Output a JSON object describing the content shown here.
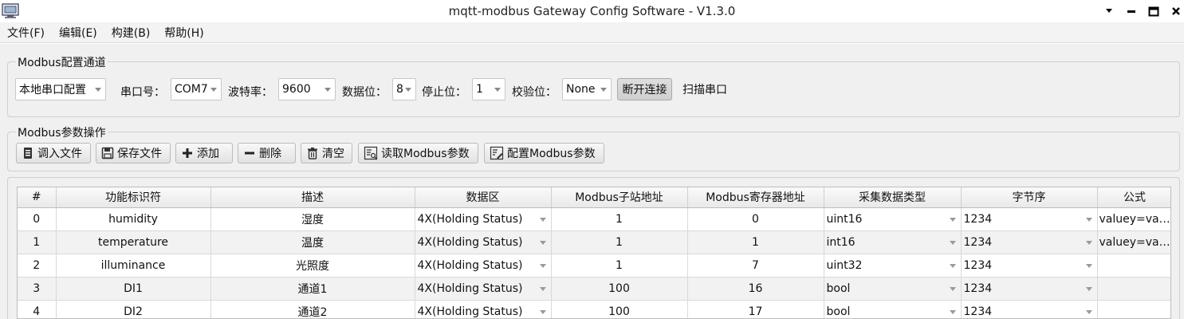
{
  "window": {
    "title": "mqtt-modbus Gateway Config Software - V1.3.0",
    "icon": "computer-app-icon"
  },
  "menu": [
    {
      "label": "文件(F)"
    },
    {
      "label": "编辑(E)"
    },
    {
      "label": "构建(B)"
    },
    {
      "label": "帮助(H)"
    }
  ],
  "channel": {
    "title": "Modbus配置通道",
    "mode": "本地串口配置",
    "port_label": "串口号：",
    "port": "COM7",
    "baud_label": "波特率：",
    "baud": "9600",
    "databits_label": "数据位：",
    "databits": "8",
    "stopbits_label": "停止位：",
    "stopbits": "1",
    "parity_label": "校验位：",
    "parity": "None",
    "disconnect_label": "断开连接",
    "scan_label": "扫描串口"
  },
  "params": {
    "title": "Modbus参数操作",
    "load_label": "调入文件",
    "save_label": "保存文件",
    "add_label": "添加",
    "delete_label": "删除",
    "clear_label": "清空",
    "read_label": "读取Modbus参数",
    "write_label": "配置Modbus参数"
  },
  "table": {
    "headers": [
      "#",
      "功能标识符",
      "描述",
      "数据区",
      "Modbus子站地址",
      "Modbus寄存器地址",
      "采集数据类型",
      "字节序",
      "公式"
    ],
    "rows": [
      {
        "idx": "0",
        "id": "humidity",
        "desc": "湿度",
        "area": "4X(Holding Status)",
        "slave": "1",
        "reg": "0",
        "type": "uint16",
        "order": "1234",
        "formula": "valuey=value..."
      },
      {
        "idx": "1",
        "id": "temperature",
        "desc": "温度",
        "area": "4X(Holding Status)",
        "slave": "1",
        "reg": "1",
        "type": "int16",
        "order": "1234",
        "formula": "valuey=value..."
      },
      {
        "idx": "2",
        "id": "illuminance",
        "desc": "光照度",
        "area": "4X(Holding Status)",
        "slave": "1",
        "reg": "7",
        "type": "uint32",
        "order": "1234",
        "formula": ""
      },
      {
        "idx": "3",
        "id": "DI1",
        "desc": "通道1",
        "area": "4X(Holding Status)",
        "slave": "100",
        "reg": "16",
        "type": "bool",
        "order": "1234",
        "formula": ""
      },
      {
        "idx": "4",
        "id": "DI2",
        "desc": "通道2",
        "area": "4X(Holding Status)",
        "slave": "100",
        "reg": "17",
        "type": "bool",
        "order": "1234",
        "formula": ""
      }
    ]
  },
  "colors": {
    "background": "#f0f0f0",
    "alt_row": "#f2f2f2",
    "border": "#bdbdbd"
  }
}
